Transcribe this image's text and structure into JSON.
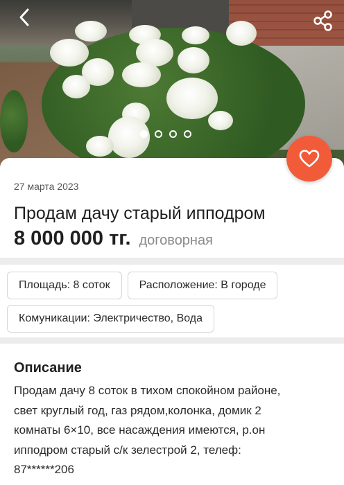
{
  "colors": {
    "accent": "#f25b3a",
    "background": "#ececec",
    "card": "#ffffff",
    "muted": "#8a8a8a"
  },
  "header": {
    "back_icon": "chevron-left-icon",
    "share_icon": "share-icon"
  },
  "gallery": {
    "photo_count": 4,
    "active_index": 0
  },
  "listing": {
    "date": "27 марта 2023",
    "title": "Продам дачу старый ипподром",
    "price": "8 000 000 тг.",
    "price_note": "договорная",
    "favorite_icon": "heart-icon"
  },
  "tags": [
    "Площадь: 8 соток",
    "Расположение: В городе",
    "Комуникации: Электричество, Вода"
  ],
  "description": {
    "heading": "Описание",
    "text_lines": [
      "Продам дачу 8 соток в тихом спокойном районе,",
      "свет круглый год, газ рядом,колонка, домик 2",
      "комнаты 6×10, все насаждения имеются, р.он",
      "ипподром старый с/к зелестрой 2, телеф:",
      "87******206"
    ]
  }
}
